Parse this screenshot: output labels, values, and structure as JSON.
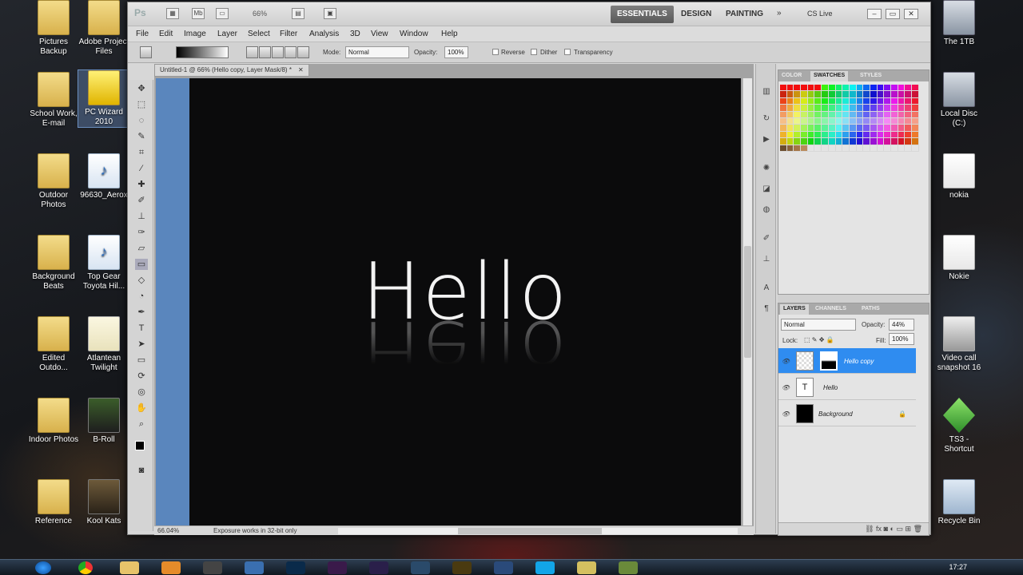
{
  "desktop": {
    "left_icons": [
      {
        "label": "Pictures Backup",
        "type": "folder"
      },
      {
        "label": "Adobe Project Files",
        "type": "folder"
      },
      {
        "label": "School Work, E-mail",
        "type": "folder"
      },
      {
        "label": "PC Wizard 2010",
        "type": "app"
      },
      {
        "label": "Outdoor Photos",
        "type": "folder"
      },
      {
        "label": "96630_Aerox",
        "type": "mp3"
      },
      {
        "label": "Background Beats",
        "type": "folder"
      },
      {
        "label": "Top Gear Toyota Hil...",
        "type": "mp3"
      },
      {
        "label": "Edited Outdo...",
        "type": "folder"
      },
      {
        "label": "Atlantean Twilight",
        "type": "thumb"
      },
      {
        "label": "Indoor Photos",
        "type": "folder"
      },
      {
        "label": "B-Roll",
        "type": "thumb"
      },
      {
        "label": "Reference",
        "type": "folder"
      },
      {
        "label": "Kool Kats",
        "type": "thumb"
      }
    ],
    "right_icons": [
      {
        "label": "The 1TB"
      },
      {
        "label": "Local Disc (C:)"
      },
      {
        "label": "nokia"
      },
      {
        "label": "Nokie"
      },
      {
        "label": "Video call snapshot 16"
      },
      {
        "label": "TS3 - Shortcut"
      },
      {
        "label": "Recycle Bin"
      }
    ],
    "clock": "17:27"
  },
  "app": {
    "logo": "Ps",
    "zoom_dropdown": "66%",
    "workspaces": [
      "ESSENTIALS",
      "DESIGN",
      "PAINTING"
    ],
    "more": "»",
    "cs_live": "CS Live",
    "menu": [
      "File",
      "Edit",
      "Image",
      "Layer",
      "Select",
      "Filter",
      "Analysis",
      "3D",
      "View",
      "Window",
      "Help"
    ],
    "options": {
      "mode_label": "Mode:",
      "mode_value": "Normal",
      "opacity_label": "Opacity:",
      "opacity_value": "100%",
      "reverse": "Reverse",
      "dither": "Dither",
      "transparency": "Transparency"
    },
    "document": {
      "tab_title": "Untitled-1 @ 66% (Hello copy, Layer Mask/8) *",
      "canvas_text": "Hello",
      "status_zoom": "66.04%",
      "status_message": "Exposure works in 32-bit only"
    },
    "color_panel_tabs": [
      "COLOR",
      "SWATCHES",
      "STYLES"
    ],
    "layers_panel": {
      "tabs": [
        "LAYERS",
        "CHANNELS",
        "PATHS"
      ],
      "blend_mode": "Normal",
      "opacity_label": "Opacity:",
      "opacity_value": "44%",
      "lock_label": "Lock:",
      "fill_label": "Fill:",
      "fill_value": "100%",
      "layers": [
        {
          "name": "Hello copy",
          "selected": true
        },
        {
          "name": "Hello",
          "selected": false
        },
        {
          "name": "Background",
          "selected": false
        }
      ]
    }
  },
  "colors": {
    "selection": "#2f8cf0",
    "canvas": "#0b0b0c",
    "blue_strip": "#5a86bd"
  }
}
